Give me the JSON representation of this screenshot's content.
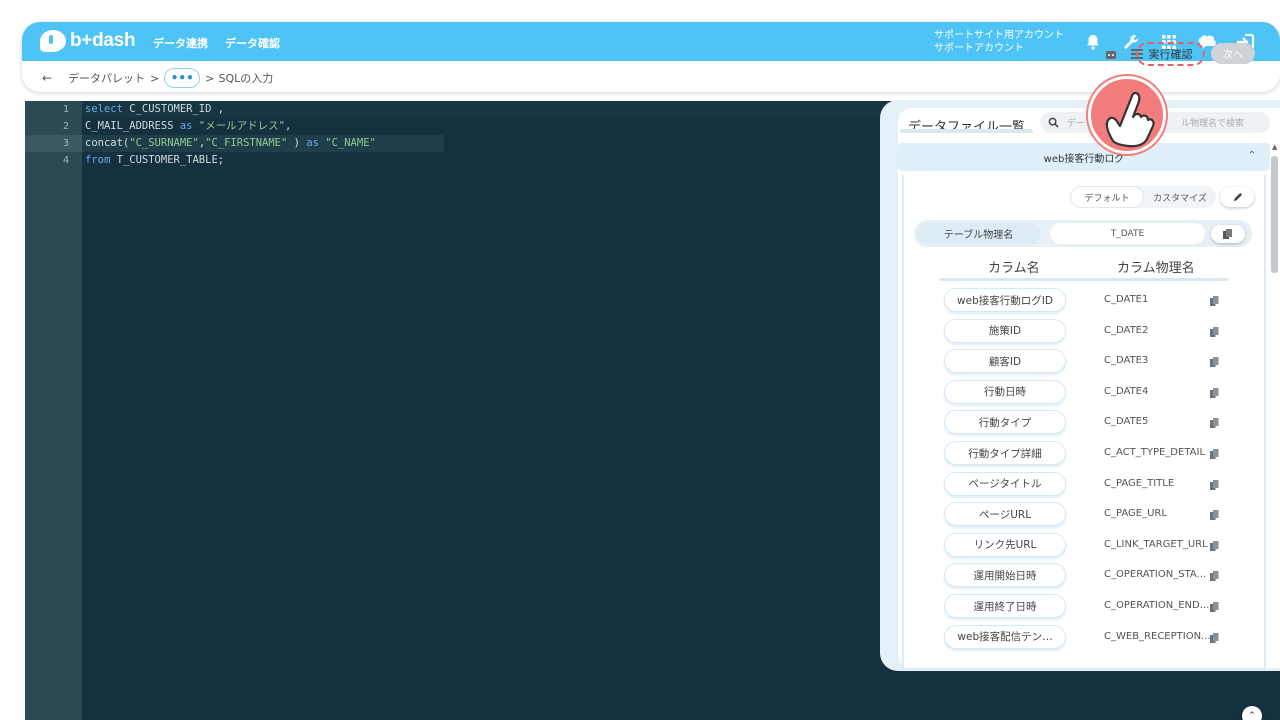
{
  "app": {
    "logo_text": "b+dash",
    "nav": [
      "データ連携",
      "データ確認"
    ],
    "account_line1": "サポートサイト用アカウント",
    "account_line2": "サポートアカウント"
  },
  "header_icons": [
    "bell-icon",
    "wrench-icon",
    "grid-icon",
    "brain-icon",
    "sign-out-icon"
  ],
  "breadcrumb": {
    "back": "←",
    "item1": "データパレット",
    "sep": ">",
    "more": "•••",
    "item2": "SQLの入力"
  },
  "toolbar": {
    "execute_label": "実行確認",
    "next_label": "次へ"
  },
  "editor": {
    "line_numbers": [
      "1",
      "2",
      "3",
      "4"
    ],
    "lines": [
      {
        "kw1": "select",
        "rest": " C_CUSTOMER_ID ,"
      },
      {
        "pre": "C_MAIL_ADDRESS ",
        "kw": "as",
        "str": " \"メールアドレス\"",
        "post": ","
      },
      {
        "pre": "concat(",
        "s1": "\"C_SURNAME\"",
        "mid": ",",
        "s2": "\"C_FIRSTNAME\"",
        "post": " ) ",
        "kw": "as",
        "s3": " \"C_NAME\""
      },
      {
        "kw1": "from",
        "rest": " T_CUSTOMER_TABLE;"
      }
    ]
  },
  "panel": {
    "title": "データファイル一覧",
    "search_placeholder_left": "デー",
    "search_placeholder_right": "ル物理名で検索",
    "accordion_title": "web接客行動ログ",
    "segment": [
      "デフォルト",
      "カスタマイズ"
    ],
    "table_label": "テーブル物理名",
    "table_value": "T_DATE",
    "col_header_name": "カラム名",
    "col_header_phys": "カラム物理名",
    "rows": [
      {
        "name": "web接客行動ログID",
        "phys": "C_DATE1"
      },
      {
        "name": "施策ID",
        "phys": "C_DATE2"
      },
      {
        "name": "顧客ID",
        "phys": "C_DATE3"
      },
      {
        "name": "行動日時",
        "phys": "C_DATE4"
      },
      {
        "name": "行動タイプ",
        "phys": "C_DATE5"
      },
      {
        "name": "行動タイプ詳細",
        "phys": "C_ACT_TYPE_DETAIL"
      },
      {
        "name": "ページタイトル",
        "phys": "C_PAGE_TITLE"
      },
      {
        "name": "ページURL",
        "phys": "C_PAGE_URL"
      },
      {
        "name": "リンク先URL",
        "phys": "C_LINK_TARGET_URL"
      },
      {
        "name": "運用開始日時",
        "phys": "C_OPERATION_STA..."
      },
      {
        "name": "運用終了日時",
        "phys": "C_OPERATION_END..."
      },
      {
        "name": "web接客配信テン…",
        "phys": "C_WEB_RECEPTION..."
      }
    ]
  }
}
